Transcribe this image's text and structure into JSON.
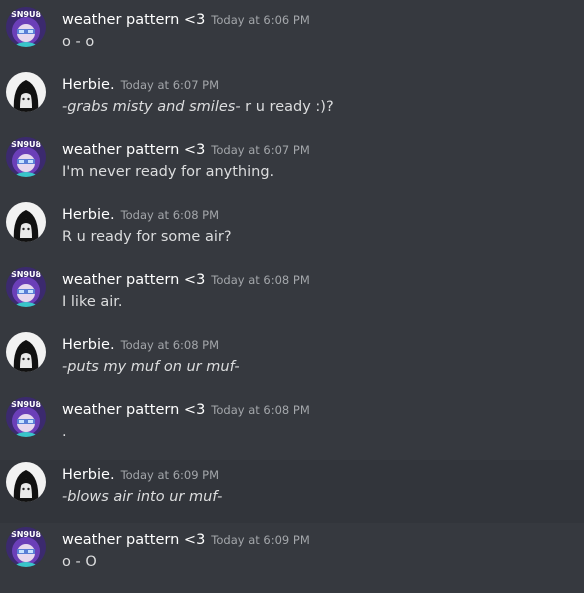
{
  "messages": [
    {
      "author": "weather pattern <3",
      "avatar": "snoob-avatar-icon",
      "timestamp": "Today at 6:06 PM",
      "parts": [
        {
          "text": "o - o",
          "italic": false
        }
      ]
    },
    {
      "author": "Herbie.",
      "avatar": "dark-hair-avatar-icon",
      "timestamp": "Today at 6:07 PM",
      "parts": [
        {
          "text": "-grabs misty and smiles-",
          "italic": true
        },
        {
          "text": " r u ready :)?",
          "italic": false
        }
      ]
    },
    {
      "author": "weather pattern <3",
      "avatar": "snoob-avatar-icon",
      "timestamp": "Today at 6:07 PM",
      "parts": [
        {
          "text": "I'm never ready for anything.",
          "italic": false
        }
      ]
    },
    {
      "author": "Herbie.",
      "avatar": "dark-hair-avatar-icon",
      "timestamp": "Today at 6:08 PM",
      "parts": [
        {
          "text": "R u ready for some air?",
          "italic": false
        }
      ]
    },
    {
      "author": "weather pattern <3",
      "avatar": "snoob-avatar-icon",
      "timestamp": "Today at 6:08 PM",
      "parts": [
        {
          "text": "I like air.",
          "italic": false
        }
      ]
    },
    {
      "author": "Herbie.",
      "avatar": "dark-hair-avatar-icon",
      "timestamp": "Today at 6:08 PM",
      "parts": [
        {
          "text": "-puts my muf on ur muf-",
          "italic": true
        }
      ]
    },
    {
      "author": "weather pattern <3",
      "avatar": "snoob-avatar-icon",
      "timestamp": "Today at 6:08 PM",
      "parts": [
        {
          "text": ".",
          "italic": false
        }
      ]
    },
    {
      "author": "Herbie.",
      "avatar": "dark-hair-avatar-icon",
      "timestamp": "Today at 6:09 PM",
      "parts": [
        {
          "text": "-blows air into ur muf-",
          "italic": true
        }
      ],
      "highlighted": true
    },
    {
      "author": "weather pattern <3",
      "avatar": "snoob-avatar-icon",
      "timestamp": "Today at 6:09 PM",
      "parts": [
        {
          "text": "o - O",
          "italic": false
        }
      ]
    }
  ],
  "avatar_text": {
    "snoob": "SN9U8"
  },
  "colors": {
    "background": "#36393f",
    "highlight": "#32353b",
    "username": "#ffffff",
    "timestamp": "#a3a6aa",
    "message_text": "#dcddde"
  }
}
